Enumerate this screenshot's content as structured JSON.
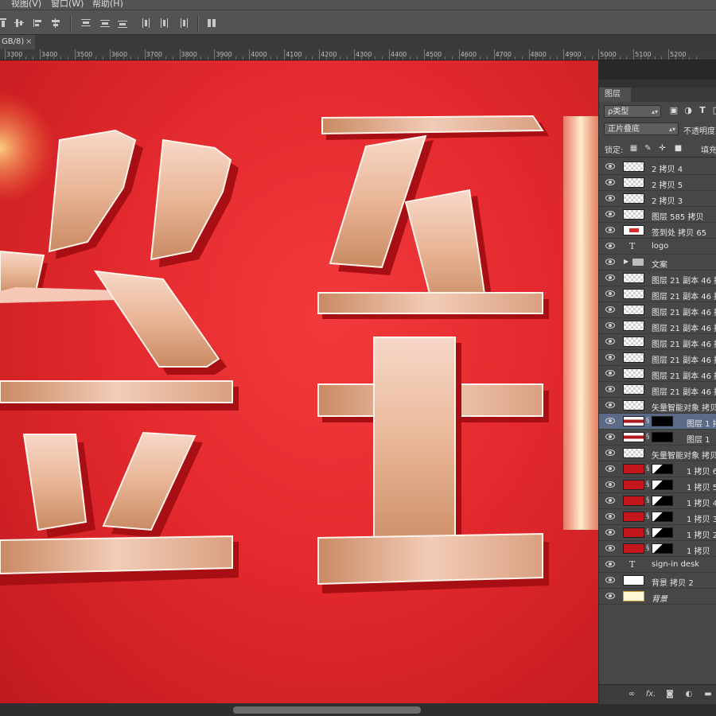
{
  "menu": {
    "items": [
      "视图(V)",
      "窗口(W)",
      "帮助(H)"
    ]
  },
  "document_tab": {
    "label": "GB/8)",
    "close": "×"
  },
  "ruler": {
    "ticks": [
      "3300",
      "3400",
      "3500",
      "3600",
      "3700",
      "3800",
      "3900",
      "4000",
      "4100",
      "4200",
      "4300",
      "4400",
      "4500",
      "4600",
      "4700",
      "4800",
      "4900",
      "5000",
      "5100",
      "5200"
    ]
  },
  "layers_panel": {
    "tab": "图层",
    "filter_kind": "ρ类型",
    "blend_mode": "正片叠底",
    "opacity_label": "不透明度",
    "lock_label": "锁定:",
    "fill_label": "填充",
    "layers": [
      {
        "name": "2 拷贝 4",
        "thumb": "checker"
      },
      {
        "name": "2 拷贝 5",
        "thumb": "checker"
      },
      {
        "name": "2 拷贝 3",
        "thumb": "checker"
      },
      {
        "name": "图层 585 拷贝",
        "thumb": "checker"
      },
      {
        "name": "签到处 拷贝 65",
        "thumb": "sign"
      },
      {
        "name": "logo",
        "thumb": "text"
      },
      {
        "name": "文案",
        "thumb": "folder"
      },
      {
        "name": "图层 21 副本 46 拷",
        "thumb": "checker"
      },
      {
        "name": "图层 21 副本 46 拷",
        "thumb": "checker"
      },
      {
        "name": "图层 21 副本 46 拷",
        "thumb": "checker"
      },
      {
        "name": "图层 21 副本 46 拷",
        "thumb": "checker"
      },
      {
        "name": "图层 21 副本 46 拷",
        "thumb": "checker"
      },
      {
        "name": "图层 21 副本 46 拷",
        "thumb": "checker"
      },
      {
        "name": "图层 21 副本 46 拷",
        "thumb": "checker"
      },
      {
        "name": "图层 21 副本 46 拷",
        "thumb": "checker"
      },
      {
        "name": "矢量智能对象 拷贝",
        "thumb": "checker"
      },
      {
        "name": "图层 1 拷",
        "thumb": "redband-mask",
        "selected": true
      },
      {
        "name": "图层 1",
        "thumb": "redband-mask"
      },
      {
        "name": "矢量智能对象 拷贝",
        "thumb": "checker"
      },
      {
        "name": "1 拷贝 6",
        "thumb": "red-mask"
      },
      {
        "name": "1 拷贝 5",
        "thumb": "red-mask"
      },
      {
        "name": "1 拷贝 4",
        "thumb": "red-mask"
      },
      {
        "name": "1 拷贝 3",
        "thumb": "red-mask"
      },
      {
        "name": "1 拷贝 2",
        "thumb": "red-mask"
      },
      {
        "name": "1 拷贝",
        "thumb": "red-mask"
      },
      {
        "name": "sign-in desk",
        "thumb": "text"
      },
      {
        "name": "背景 拷贝 2",
        "thumb": "white"
      },
      {
        "name": "背景",
        "thumb": "yellow",
        "italic": true
      }
    ],
    "footer_icons": [
      "link-icon",
      "fx-icon",
      "mask-icon",
      "adjustment-icon",
      "folder-icon"
    ]
  },
  "colors": {
    "canvas_red": "#e42a2e",
    "panel_bg": "#474747",
    "selected_row": "#5b6a86"
  }
}
